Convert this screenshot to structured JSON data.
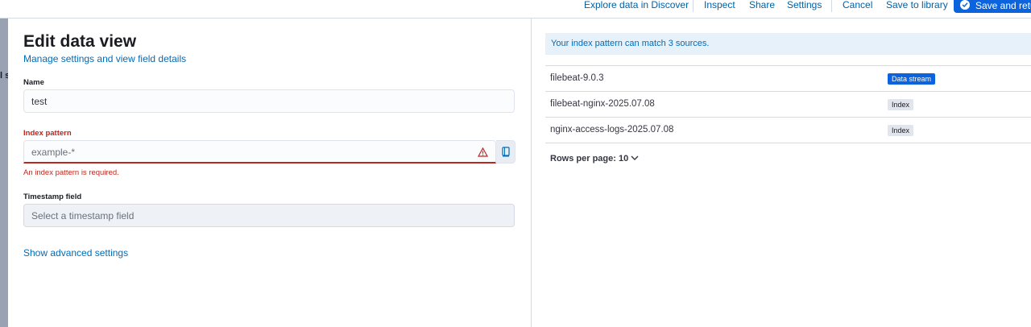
{
  "topbar": {
    "explore": "Explore data in Discover",
    "inspect": "Inspect",
    "share": "Share",
    "settings": "Settings",
    "cancel": "Cancel",
    "save_library": "Save to library",
    "save_return": "Save and retu"
  },
  "background_glyph": "l st",
  "form": {
    "title": "Edit data view",
    "subtitle": "Manage settings and view field details",
    "name_label": "Name",
    "name_value": "test",
    "index_label": "Index pattern",
    "index_placeholder": "example-*",
    "index_error": "An index pattern is required.",
    "timestamp_label": "Timestamp field",
    "timestamp_placeholder": "Select a timestamp field",
    "advanced_link": "Show advanced settings"
  },
  "sources": {
    "callout": "Your index pattern can match 3 sources.",
    "rows": [
      {
        "name": "filebeat-9.0.3",
        "type": "Data stream"
      },
      {
        "name": "filebeat-nginx-2025.07.08",
        "type": "Index"
      },
      {
        "name": "nginx-access-logs-2025.07.08",
        "type": "Index"
      }
    ],
    "rows_per_page": "Rows per page: 10"
  },
  "colors": {
    "accent": "#0b64dd",
    "link": "#006bb8",
    "danger": "#bd271e"
  }
}
